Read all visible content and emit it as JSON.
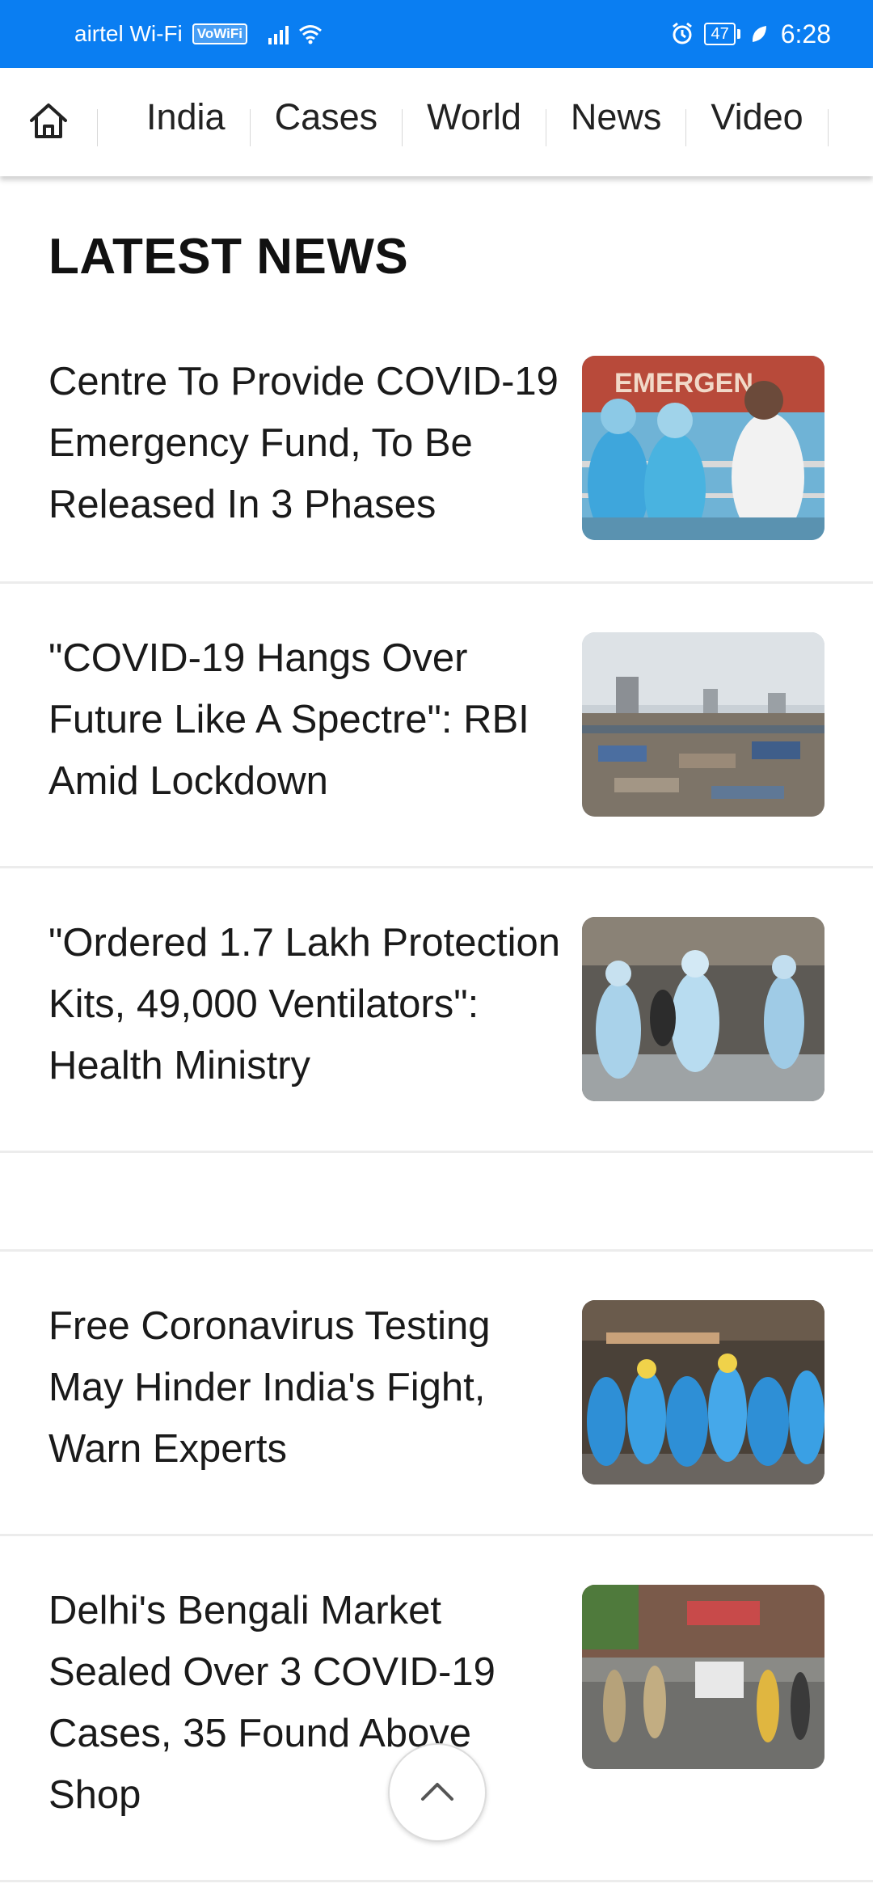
{
  "status_bar": {
    "carrier": "airtel Wi-Fi",
    "vowifi_badge": "VoWiFi",
    "battery_level": "47",
    "time": "6:28",
    "background_color": "#0a7ef2",
    "icons": [
      "signal-icon",
      "wifi-icon",
      "alarm-icon",
      "battery-icon",
      "leaf-icon"
    ]
  },
  "nav": {
    "home_icon": "home-icon",
    "tabs": [
      {
        "label": "India"
      },
      {
        "label": "Cases"
      },
      {
        "label": "World"
      },
      {
        "label": "News"
      },
      {
        "label": "Video"
      }
    ]
  },
  "main": {
    "section_title": "LATEST NEWS",
    "articles": [
      {
        "headline": "Centre To Provide COVID-19 Emergency Fund, To Be Released In 3 Phases",
        "thumbnail": "healthcare workers in PPE at emergency entrance"
      },
      {
        "headline": "\"COVID-19 Hangs Over Future Like A Spectre\": RBI Amid Lockdown",
        "thumbnail": "city skyline over slum rooftops"
      },
      {
        "headline": "\"Ordered 1.7 Lakh Protection Kits, 49,000 Ventilators\": Health Ministry",
        "thumbnail": "medical staff in protective suits at entrance"
      },
      {
        "headline": "Free Coronavirus Testing May Hinder India's Fight, Warn Experts",
        "thumbnail": "group of workers in blue protective suits"
      },
      {
        "headline": "Delhi's Bengali Market Sealed Over 3 COVID-19 Cases, 35 Found Above Shop",
        "thumbnail": "police officers on a market street"
      }
    ]
  },
  "scroll_top": {
    "icon": "chevron-up-icon"
  }
}
